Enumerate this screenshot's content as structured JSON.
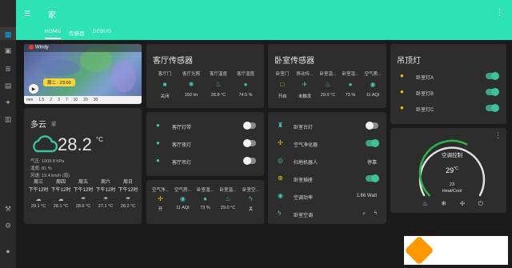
{
  "header": {
    "title": "家",
    "tabs": [
      "HOME",
      "传感器",
      "DEBUG"
    ]
  },
  "map": {
    "brand": "Windy",
    "time_label": "周二 - 23:00",
    "scale": [
      "mm",
      "1.5",
      "2",
      "3",
      "7",
      "10",
      "20",
      "30"
    ]
  },
  "weather": {
    "condition": "多云",
    "location": "家",
    "temperature": "28.2",
    "unit": "°C",
    "pressure": "气压: 1008.8 hPa",
    "humidity": "湿度: 81 %",
    "wind": "风速: 19.4 km/h (南)",
    "forecast": [
      {
        "day": "周三",
        "time": "下午12时",
        "icon": "cloudy-icon",
        "temp": "29.1 °C"
      },
      {
        "day": "周四",
        "time": "下午12时",
        "icon": "cloudy-icon",
        "temp": "28.1 °C"
      },
      {
        "day": "周五",
        "time": "下午12时",
        "icon": "rain-icon",
        "temp": "28.6 °C"
      },
      {
        "day": "周六",
        "time": "下午12时",
        "icon": "rain-icon",
        "temp": "27.1 °C"
      },
      {
        "day": "周日",
        "time": "下午12时",
        "icon": "rain-icon",
        "temp": "28.2 °C"
      }
    ]
  },
  "living_sensors": {
    "title": "客厅传感器",
    "items": [
      {
        "name": "客厅门",
        "icon": "door-icon",
        "value": "关闭"
      },
      {
        "name": "客厅光照",
        "icon": "brightness-icon",
        "value": "160 lm"
      },
      {
        "name": "客厅温度",
        "icon": "thermometer-icon",
        "value": "28.8 °C"
      },
      {
        "name": "客厅湿度",
        "icon": "droplet-icon",
        "value": "74.5 %"
      }
    ]
  },
  "bedroom_sensors": {
    "title": "卧室传感器",
    "items": [
      {
        "name": "卧室门",
        "icon": "door-icon",
        "value": "开启"
      },
      {
        "name": "移动传...",
        "icon": "motion-icon",
        "value": "未触发"
      },
      {
        "name": "卧室温...",
        "icon": "thermometer-icon",
        "value": "29.0 °C"
      },
      {
        "name": "卧室湿...",
        "icon": "droplet-icon",
        "value": "73 %"
      },
      {
        "name": "空气质...",
        "icon": "eye-icon",
        "value": "11 AQI"
      }
    ]
  },
  "ceiling": {
    "title": "吊顶灯",
    "items": [
      {
        "label": "卧室灯A",
        "on": true
      },
      {
        "label": "卧室灯B",
        "on": true
      },
      {
        "label": "卧室灯C",
        "on": true
      }
    ]
  },
  "living_lights": {
    "items": [
      {
        "label": "客厅灯带",
        "on": false
      },
      {
        "label": "客厅夜灯",
        "on": false
      },
      {
        "label": "客厅吊灯",
        "on": false
      }
    ]
  },
  "air_sensors": {
    "items": [
      {
        "name": "空气净...",
        "icon": "fan-icon",
        "value": "开"
      },
      {
        "name": "空气质...",
        "icon": "eye-icon",
        "value": "11 AQI"
      },
      {
        "name": "卧室湿...",
        "icon": "droplet-icon",
        "value": "73 %"
      },
      {
        "name": "卧室温...",
        "icon": "thermometer-icon",
        "value": "29.0 °C"
      },
      {
        "name": "卧室空...",
        "icon": "bolt-icon",
        "value": "关"
      }
    ]
  },
  "bedroom_devices": {
    "items": [
      {
        "label": "卧室台灯",
        "icon": "lamp-icon",
        "toggle": false
      },
      {
        "label": "空气净化器",
        "icon": "fan-icon",
        "toggle": true
      },
      {
        "label": "扫地机器人",
        "icon": "robot-icon",
        "state": "停靠"
      },
      {
        "label": "卧室插座",
        "icon": "plug-icon",
        "toggle": true
      },
      {
        "label": "空调功率",
        "icon": "eye-icon",
        "state": "1.66 Watt"
      },
      {
        "label": "卧室空调",
        "icon": "bolt-icon",
        "state": ""
      }
    ]
  },
  "thermostat": {
    "title": "空调控制",
    "target": "29",
    "unit": "°C",
    "current": "23",
    "mode": "Heat/Cool",
    "modes": [
      "fire-icon",
      "snowflake-icon",
      "fan-icon",
      "power-icon"
    ],
    "target_fraction": 0.6
  },
  "colors": {
    "accent": "#2de3b3",
    "teal": "#45c4b0",
    "bulb": "#ffc107",
    "card": "#2d2d2d"
  }
}
